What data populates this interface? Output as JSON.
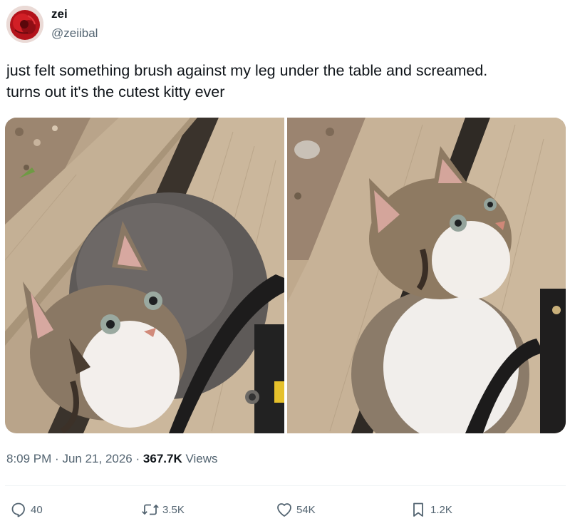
{
  "author": {
    "display_name": "zei",
    "handle": "@zeiibal",
    "avatar_icon": "red-flower-avatar"
  },
  "tweet": {
    "text_line_1": "just felt something brush against my leg under the table and screamed.",
    "text_line_2": "turns out it's the cutest kitty ever"
  },
  "media": {
    "photos": [
      {
        "subject": "kitten looking up on wooden deck"
      },
      {
        "subject": "kitten sitting on wooden deck looking up"
      }
    ]
  },
  "meta": {
    "time": "8:09 PM",
    "separator": "·",
    "date": "Jun 21, 2026",
    "views_count": "367.7K",
    "views_label": "Views"
  },
  "actions": {
    "reply": {
      "icon": "reply-icon",
      "count": "40"
    },
    "retweet": {
      "icon": "retweet-icon",
      "count": "3.5K"
    },
    "like": {
      "icon": "heart-icon",
      "count": "54K"
    },
    "bookmark": {
      "icon": "bookmark-icon",
      "count": "1.2K"
    }
  },
  "colors": {
    "text_primary": "#0f1419",
    "text_secondary": "#536471",
    "divider": "#eff3f4"
  }
}
